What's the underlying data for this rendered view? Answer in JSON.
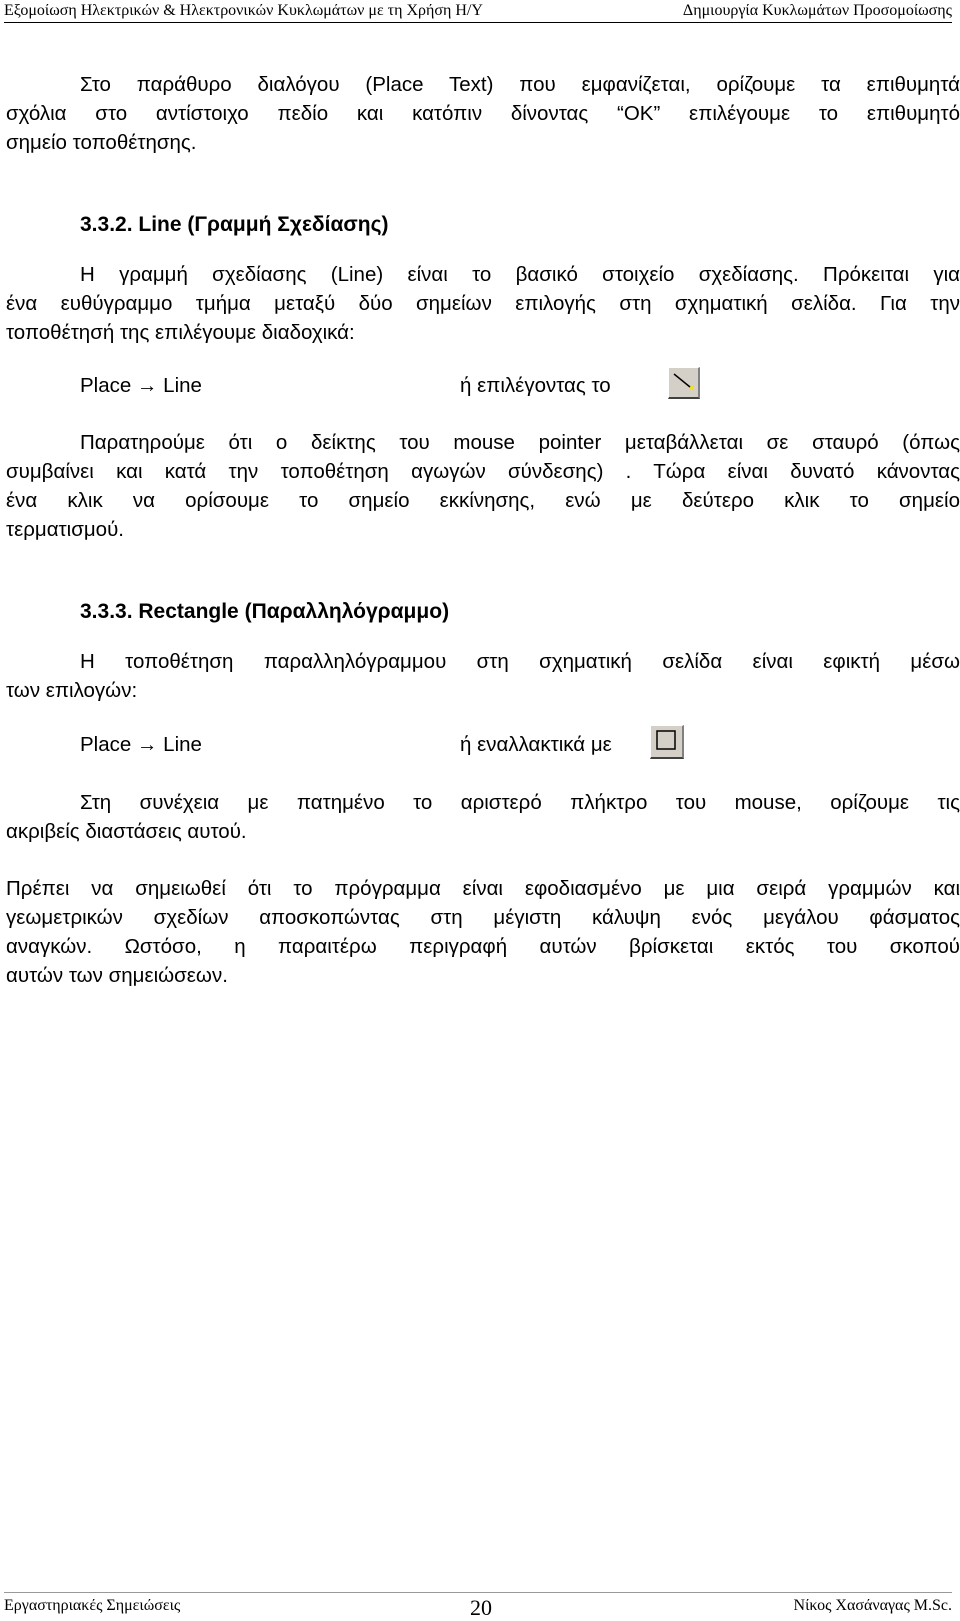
{
  "header": {
    "left": "Εξομοίωση Ηλεκτρικών & Ηλεκτρονικών Κυκλωμάτων με τη Χρήση Η/Υ",
    "right": "Δημιουργία Κυκλωμάτων Προσομοίωσης"
  },
  "intro": {
    "lines": [
      "Στο παράθυρο διαλόγου (Place Text) που εμφανίζεται, ορίζουμε τα επιθυμητά",
      "σχόλια στο αντίστοιχο πεδίο και κατόπιν δίνοντας “OK” επιλέγουμε το επιθυμητό",
      "σημείο τοποθέτησης."
    ]
  },
  "section_line": {
    "heading": "3.3.2. Line (Γραμμή Σχεδίασης)",
    "para1": [
      "Η γραμμή σχεδίασης (Line) είναι το βασικό στοιχείο σχεδίασης. Πρόκειται για",
      "ένα ευθύγραμμο τμήμα μεταξύ δύο σημείων επιλογής στη σχηματική σελίδα. Για την",
      "τοποθέτησή της επιλέγουμε διαδοχικά:"
    ],
    "menu_path": "Place → Line",
    "alt_text": "ή επιλέγοντας το",
    "tool_icon": "line-tool-icon",
    "para2": [
      "Παρατηρούμε ότι ο δείκτης του mouse pointer μεταβάλλεται σε σταυρό (όπως",
      "συμβαίνει και κατά την τοποθέτηση αγωγών σύνδεσης) . Τώρα είναι δυνατό κάνοντας",
      "ένα κλικ να ορίσουμε το σημείο εκκίνησης, ενώ με δεύτερο κλικ το σημείο",
      "τερματισμού."
    ]
  },
  "section_rect": {
    "heading": "3.3.3. Rectangle (Παραλληλόγραμμο)",
    "para1": [
      "Η τοποθέτηση παραλληλόγραμμου στη σχηματική σελίδα είναι εφικτή μέσω",
      "των επιλογών:"
    ],
    "menu_path": "Place → Line",
    "alt_text": "ή εναλλακτικά με",
    "tool_icon": "rectangle-tool-icon",
    "para2": [
      "Στη συνέχεια με πατημένο το αριστερό πλήκτρο του mouse, ορίζουμε τις",
      "ακριβείς διαστάσεις αυτού."
    ],
    "para3": [
      "Πρέπει να σημειωθεί ότι το πρόγραμμα είναι εφοδιασμένο με μια σειρά γραμμών και",
      "γεωμετρικών σχεδίων αποσκοπώντας στη μέγιστη κάλυψη ενός μεγάλου φάσματος",
      "αναγκών. Ωστόσο, η παραιτέρω περιγραφή αυτών βρίσκεται εκτός του σκοπού",
      "αυτών των σημειώσεων."
    ]
  },
  "footer": {
    "left": "Εργαστηριακές Σημειώσεις",
    "page_number": "20",
    "right": "Νίκος Χασάναγας M.Sc."
  }
}
